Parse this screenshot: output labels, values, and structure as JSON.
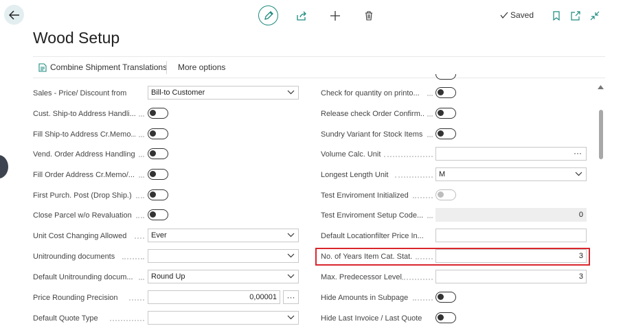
{
  "header": {
    "title": "Wood Setup",
    "status": "Saved"
  },
  "actions": {
    "combine": "Combine Shipment Translations",
    "more": "More options"
  },
  "left_fields": [
    {
      "label": "Sales - Price/ Discount from",
      "type": "select",
      "value": "Bill-to Customer"
    },
    {
      "label": "Cust. Ship-to Address Handli...",
      "type": "toggle",
      "value": "off"
    },
    {
      "label": "Fill Ship-to Address Cr.Memo...",
      "type": "toggle",
      "value": "off"
    },
    {
      "label": "Vend. Order Address Handling",
      "type": "toggle",
      "value": "off"
    },
    {
      "label": "Fill Order Address Cr.Memo/...",
      "type": "toggle",
      "value": "off"
    },
    {
      "label": "First Purch. Post (Drop Ship.)",
      "type": "toggle",
      "value": "off"
    },
    {
      "label": "Close Parcel w/o Revaluation",
      "type": "toggle",
      "value": "off"
    },
    {
      "label": "Unit Cost Changing Allowed",
      "type": "select",
      "value": "Ever"
    },
    {
      "label": "Unitrounding documents",
      "type": "select",
      "value": ""
    },
    {
      "label": "Default Unitrounding docum...",
      "type": "select",
      "value": "Round Up"
    },
    {
      "label": "Price Rounding Precision",
      "type": "number-lookup",
      "value": "0,00001"
    },
    {
      "label": "Default Quote Type",
      "type": "select",
      "value": ""
    }
  ],
  "right_fields": [
    {
      "label": "Check for quantity on printo...",
      "type": "toggle",
      "value": "off"
    },
    {
      "label": "Release check Order Confirm...",
      "type": "toggle",
      "value": "off"
    },
    {
      "label": "Sundry Variant for Stock Items",
      "type": "toggle",
      "value": "off"
    },
    {
      "label": "Volume Calc. Unit",
      "type": "lookup",
      "value": ""
    },
    {
      "label": "Longest Length Unit",
      "type": "select",
      "value": "M"
    },
    {
      "label": "Test Enviroment Initialized",
      "type": "toggle",
      "value": "off",
      "disabled": true
    },
    {
      "label": "Test Enviroment Setup Code...",
      "type": "readonly",
      "value": "0"
    },
    {
      "label": "Default Locationfilter Price In...",
      "type": "text",
      "value": ""
    },
    {
      "label": "No. of Years Item Cat. Stat.",
      "type": "number",
      "value": "3"
    },
    {
      "label": "Max. Predecessor Level",
      "type": "number",
      "value": "3"
    },
    {
      "label": "Hide Amounts in Subpage",
      "type": "toggle",
      "value": "off"
    },
    {
      "label": "Hide Last Invoice / Last Quote",
      "type": "toggle",
      "value": "off"
    }
  ],
  "icons": {
    "back": "arrow-left-icon",
    "edit": "pencil-icon",
    "share": "share-icon",
    "new": "plus-icon",
    "delete": "trash-icon",
    "saved": "checkmark-icon",
    "bookmark": "bookmark-icon",
    "open_new": "open-in-new-window-icon",
    "collapse": "collapse-icon",
    "combine": "document-icon",
    "chevron": "chevron-down-icon",
    "scroll_up": "triangle-up-icon"
  },
  "colors": {
    "accent": "#1b8a7d",
    "highlight_box": "#d9262c",
    "back_button_bg": "#e3eef0"
  }
}
